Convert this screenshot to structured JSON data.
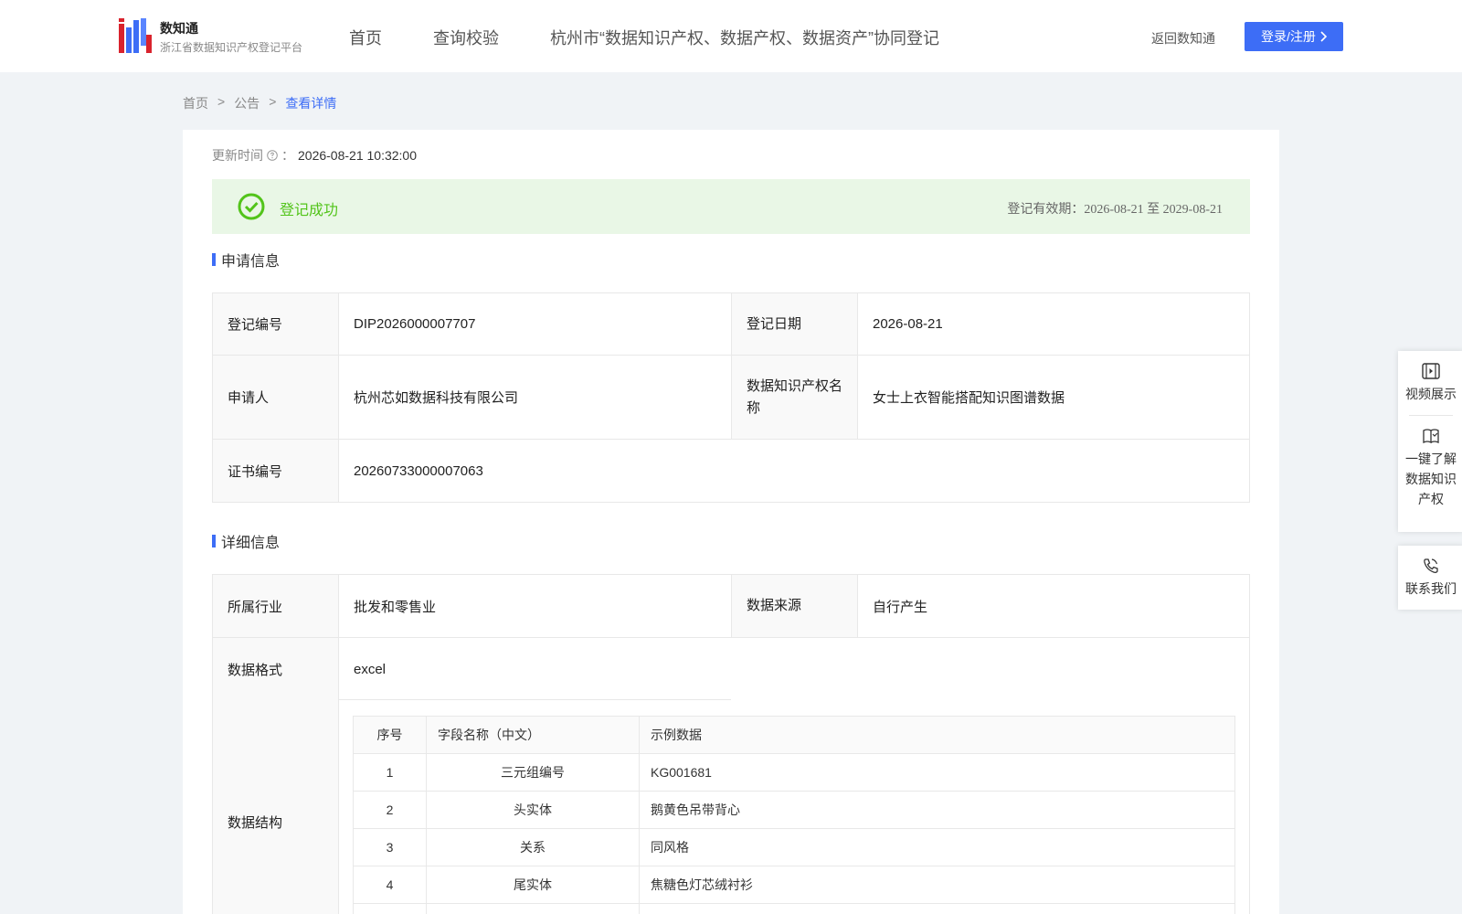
{
  "header": {
    "logo_title": "数知通",
    "logo_subtitle": "浙江省数据知识产权登记平台",
    "nav": [
      "首页",
      "查询校验",
      "杭州市“数据知识产权、数据产权、数据资产”协同登记"
    ],
    "back_link": "返回数知通",
    "login_label": "登录/注册"
  },
  "breadcrumb": [
    "首页",
    ">",
    "公告",
    ">",
    "查看详情"
  ],
  "update": {
    "label": "更新时间",
    "sep": "：",
    "value": "2026-08-21 10:32:00"
  },
  "status": {
    "text": "登记成功",
    "validity": "登记有效期：2026-08-21 至 2029-08-21",
    "color": "#52c41a"
  },
  "application": {
    "title": "申请信息",
    "reg_no_label": "登记编号",
    "reg_no": "DIP2026000007707",
    "reg_date_label": "登记日期",
    "reg_date": "2026-08-21",
    "applicant_label": "申请人",
    "applicant": "杭州芯如数据科技有限公司",
    "ip_name_label": "数据知识产权名称",
    "ip_name": "女士上衣智能搭配知识图谱数据",
    "cert_no_label": "证书编号",
    "cert_no": "20260733000007063"
  },
  "detail": {
    "title": "详细信息",
    "industry_label": "所属行业",
    "industry": "批发和零售业",
    "source_label": "数据来源",
    "source": "自行产生",
    "format_label": "数据格式",
    "format": "excel",
    "structure_label": "数据结构",
    "field_headers": [
      "序号",
      "字段名称（中文）",
      "示例数据"
    ],
    "fields": [
      {
        "no": "1",
        "name": "三元组编号",
        "sample": "KG001681"
      },
      {
        "no": "2",
        "name": "头实体",
        "sample": "鹅黄色吊带背心"
      },
      {
        "no": "3",
        "name": "关系",
        "sample": "同风格"
      },
      {
        "no": "4",
        "name": "尾实体",
        "sample": "焦糖色灯芯绒衬衫"
      }
    ]
  },
  "side": {
    "video": "视频展示",
    "learn": [
      "一键了解",
      "数据知识",
      "产权"
    ],
    "contact": "联系我们"
  },
  "colors": {
    "accent": "#3d6df6",
    "success_bg": "#e9f7e6"
  }
}
